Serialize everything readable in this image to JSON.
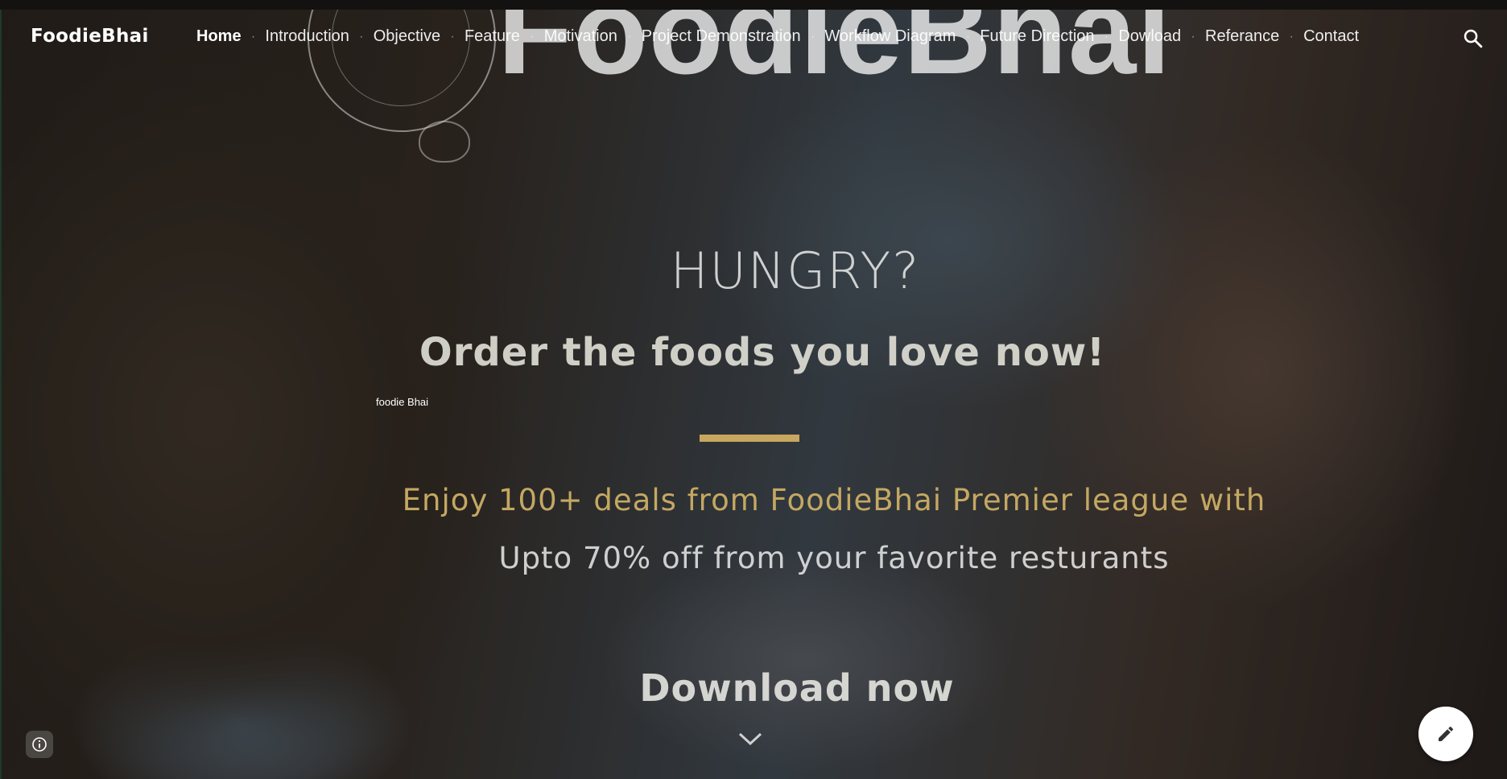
{
  "header": {
    "site_title": "FoodieBhai",
    "nav_items": [
      {
        "label": "Home",
        "active": true
      },
      {
        "label": "Introduction",
        "active": false
      },
      {
        "label": "Objective",
        "active": false
      },
      {
        "label": "Feature",
        "active": false
      },
      {
        "label": "Motivation",
        "active": false
      },
      {
        "label": "Project Demonstration",
        "active": false
      },
      {
        "label": "Workflow Diagram",
        "active": false
      },
      {
        "label": "Future Direction",
        "active": false
      },
      {
        "label": "Dowload",
        "active": false
      },
      {
        "label": "Referance",
        "active": false
      },
      {
        "label": "Contact",
        "active": false
      }
    ],
    "search_icon": "search-icon"
  },
  "hero": {
    "logo_text": "FoodieBhai",
    "heading": "HUNGRY?",
    "subheading": "Order the foods you love now!",
    "caption": "foodie Bhai",
    "deal_line_1": "Enjoy 100+ deals from FoodieBhai Premier league with",
    "deal_line_2": "Upto 70% off from your favorite resturants",
    "download_label": "Download now",
    "scroll_icon": "chevron-down-icon"
  },
  "floating": {
    "info_icon": "info-icon",
    "edit_icon": "pencil-icon"
  },
  "colors": {
    "accent_gold": "#c7a75f",
    "deal_text": "#c4a862",
    "nav_text": "#ffffff"
  }
}
